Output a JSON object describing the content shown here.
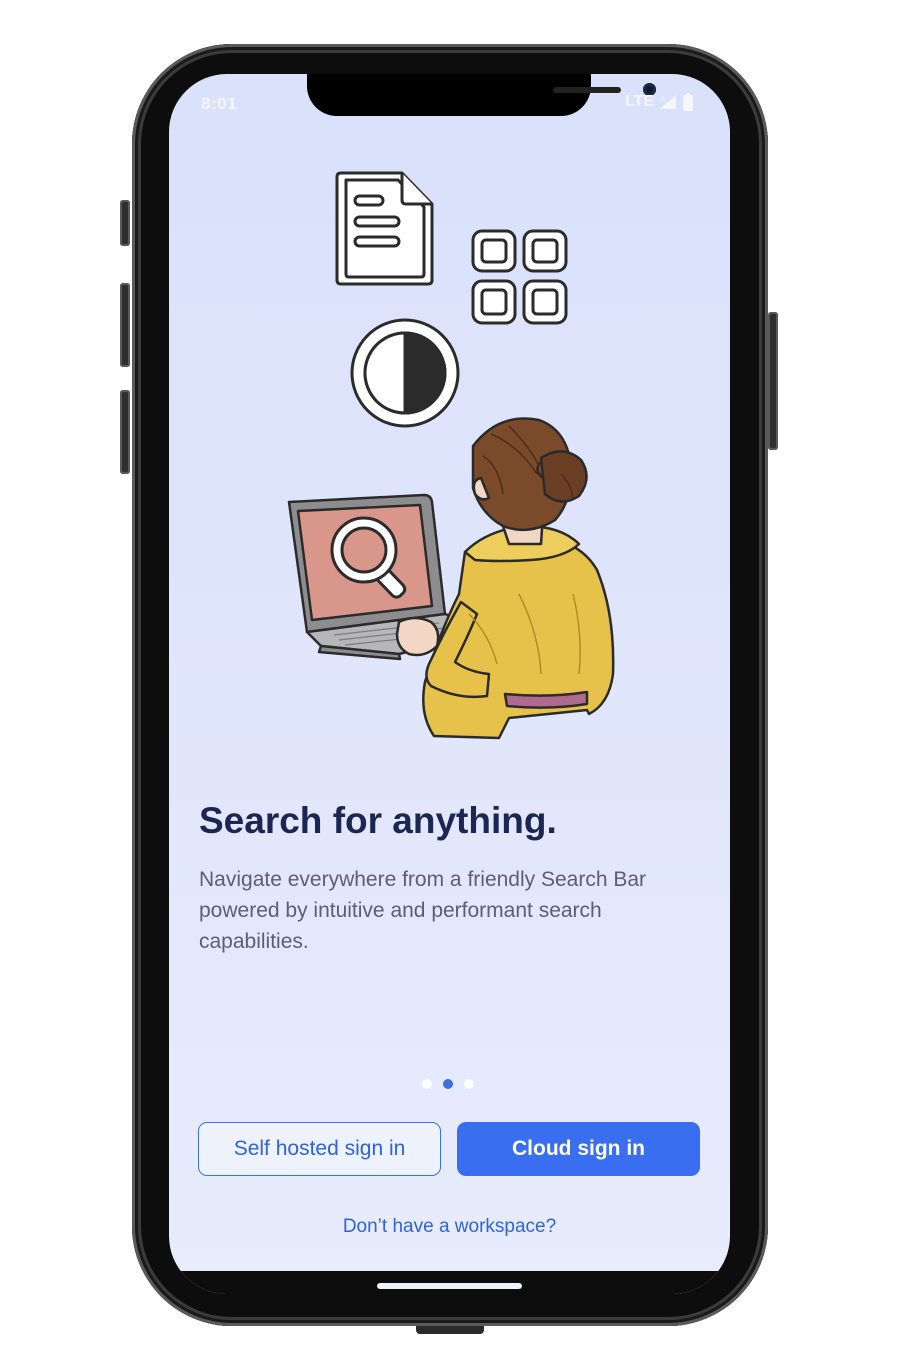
{
  "status_bar": {
    "time": "8:01",
    "network": "LTE",
    "icons": [
      "signal-icon",
      "battery-icon"
    ]
  },
  "illustration": {
    "icons": [
      "document-icon",
      "apps-grid-icon",
      "contrast-icon",
      "search-icon"
    ],
    "colors": {
      "jacket": "#e7c24a",
      "laptop_screen": "#d9968b",
      "hair": "#7a4a2b"
    }
  },
  "onboarding": {
    "headline": "Search for anything.",
    "description": "Navigate everywhere from a friendly Search Bar powered by intuitive and performant search capabilities.",
    "page_count": 3,
    "active_page": 2
  },
  "actions": {
    "self_hosted_label": "Self hosted sign in",
    "cloud_label": "Cloud sign in",
    "workspace_link": "Don’t have a workspace?"
  },
  "colors": {
    "accent": "#3a6ef0",
    "headline": "#1b2652",
    "background": "#dfe5fb"
  }
}
